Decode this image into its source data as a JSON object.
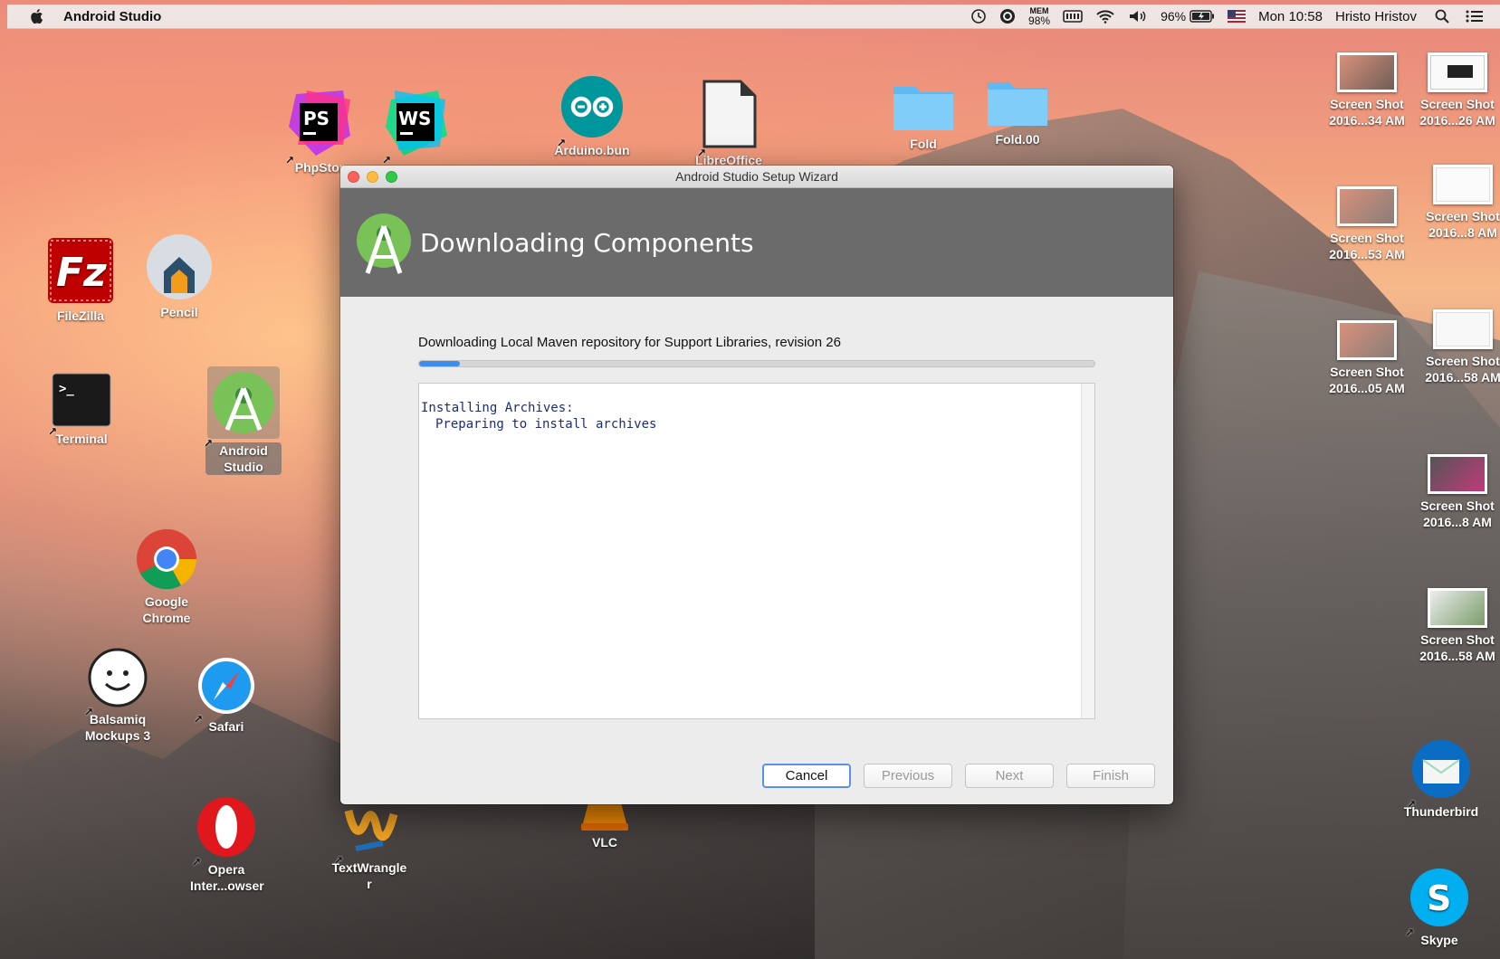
{
  "menubar": {
    "app_name": "Android Studio",
    "mem_label": "MEM",
    "mem_value": "98%",
    "battery": "96%",
    "clock": "Mon 10:58",
    "user": "Hristo Hristov"
  },
  "desktop_icons": {
    "phpstorm": "PhpStor",
    "webstorm": "",
    "arduino": "Arduino.bun",
    "libreoffice": "LibreOffice",
    "fold1": "Fold",
    "fold2": "Fold.00",
    "filezilla": "FileZilla",
    "pencil": "Pencil",
    "terminal": "Terminal",
    "android_studio": "Android Studio",
    "chrome": "Google Chrome",
    "balsamiq": "Balsamiq Mockups 3",
    "safari": "Safari",
    "opera": "Opera Inter...owser",
    "textwrangler": "TextWrangler",
    "vlc": "VLC",
    "thunderbird": "Thunderbird",
    "skype": "Skype",
    "shots": [
      {
        "l1": "Screen Shot",
        "l2": "2016...34 AM"
      },
      {
        "l1": "Screen Shot",
        "l2": "2016...26 AM"
      },
      {
        "l1": "Screen Shot",
        "l2": "2016...53 AM"
      },
      {
        "l1": "Screen Shot",
        "l2": "2016...8 AM"
      },
      {
        "l1": "Screen Shot",
        "l2": "2016...05 AM"
      },
      {
        "l1": "Screen Shot",
        "l2": "2016...58 AM"
      },
      {
        "l1": "Screen Shot",
        "l2": "2016...8 AM"
      },
      {
        "l1": "Screen Shot",
        "l2": "2016...58 AM"
      }
    ]
  },
  "window": {
    "title": "Android Studio Setup Wizard",
    "header": "Downloading Components",
    "status": "Downloading Local Maven repository for Support Libraries, revision 26",
    "progress": 0.06,
    "log_line1": "Installing Archives:",
    "log_line2": "Preparing to install archives",
    "buttons": {
      "cancel": "Cancel",
      "previous": "Previous",
      "next": "Next",
      "finish": "Finish"
    }
  },
  "colors": {
    "accent": "#3d8ee8",
    "header_bg": "#6b6b6b"
  }
}
